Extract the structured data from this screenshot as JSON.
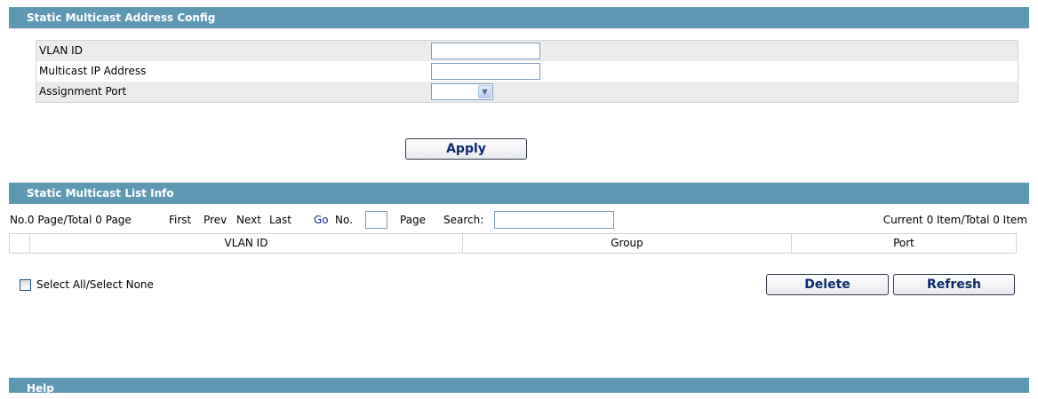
{
  "config": {
    "title": "Static Multicast Address Config",
    "fields": [
      {
        "label": "VLAN ID",
        "value": ""
      },
      {
        "label": "Multicast IP Address",
        "value": ""
      },
      {
        "label": "Assignment Port",
        "value": ""
      }
    ],
    "apply_label": "Apply"
  },
  "list": {
    "title": "Static Multicast List Info",
    "pager": {
      "status": "No.0 Page/Total 0 Page",
      "first": "First",
      "prev": "Prev",
      "next": "Next",
      "last": "Last",
      "go": "Go",
      "no_label": "No.",
      "page_label": "Page",
      "search_label": "Search:",
      "item_status": "Current 0 Item/Total 0 Item"
    },
    "columns": [
      "VLAN ID",
      "Group",
      "Port"
    ],
    "select_all_label": "Select All/Select None",
    "delete_label": "Delete",
    "refresh_label": "Refresh"
  },
  "help": {
    "title": "Help"
  },
  "colors": {
    "header_bg": "#5f98b2",
    "row_shade": "#ececec"
  }
}
